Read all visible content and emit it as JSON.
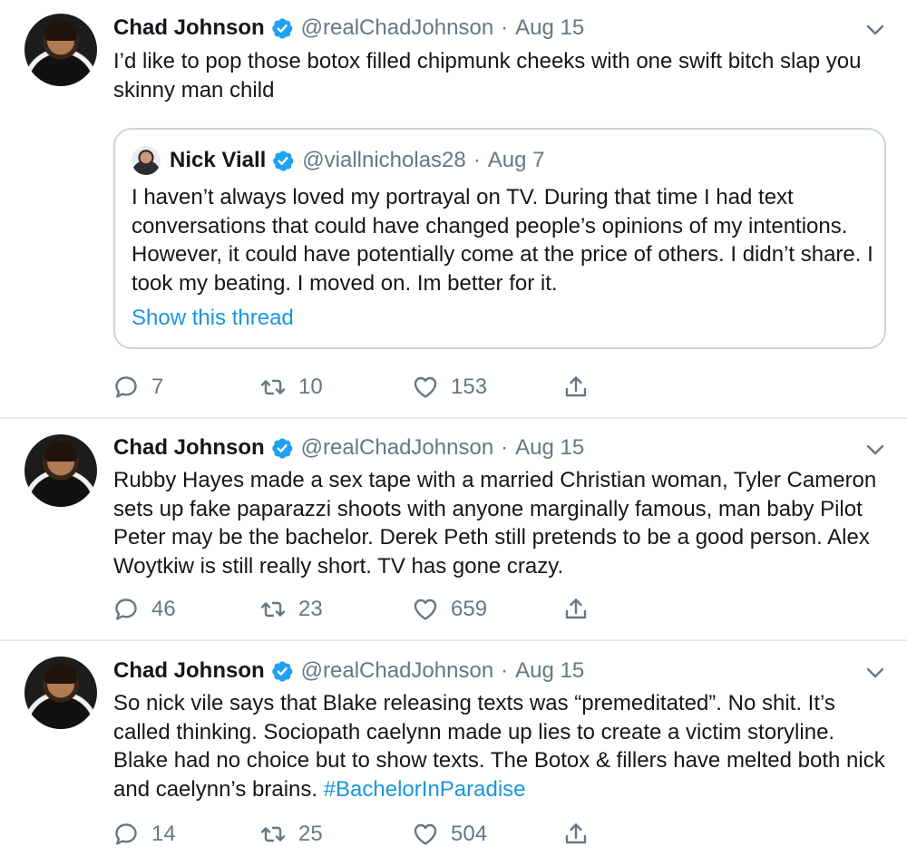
{
  "colors": {
    "link": "#1b95e0",
    "muted": "#657786",
    "text": "#14171a",
    "border": "#ccd6dd"
  },
  "icons": {
    "verified": "verified-badge-icon",
    "caret": "chevron-down-icon",
    "reply": "reply-icon",
    "retweet": "retweet-icon",
    "like": "heart-icon",
    "share": "share-icon"
  },
  "tweets": [
    {
      "author": {
        "name": "Chad Johnson",
        "handle": "@realChadJohnson",
        "separator": "·",
        "date": "Aug 15"
      },
      "text": "I’d like to pop those botox filled chipmunk cheeks with one swift bitch slap you skinny man child",
      "quote": {
        "author": {
          "name": "Nick Viall",
          "handle": "@viallnicholas28",
          "separator": "·",
          "date": "Aug 7"
        },
        "text": "I haven’t always loved my portrayal on TV.  During that time I had text conversations that could have changed people’s opinions of my intentions. However, it could have potentially come at the price of others.  I didn’t share.  I took my beating. I moved on.  Im better for it.",
        "link": "Show this thread"
      },
      "stats": {
        "replies": "7",
        "retweets": "10",
        "likes": "153"
      }
    },
    {
      "author": {
        "name": "Chad Johnson",
        "handle": "@realChadJohnson",
        "separator": "·",
        "date": "Aug 15"
      },
      "text": "Rubby Hayes made a sex tape with a married Christian woman, Tyler Cameron sets up fake paparazzi shoots with anyone marginally famous, man baby Pilot Peter may be the bachelor. Derek Peth still pretends to be a good person. Alex Woytkiw is still really short. TV has gone crazy.",
      "stats": {
        "replies": "46",
        "retweets": "23",
        "likes": "659"
      }
    },
    {
      "author": {
        "name": "Chad Johnson",
        "handle": "@realChadJohnson",
        "separator": "·",
        "date": "Aug 15"
      },
      "text": "So nick vile says that Blake releasing texts was “premeditated”. No shit. It’s called thinking. Sociopath caelynn made up lies to create a victim storyline. Blake had no choice but to show texts. The Botox & fillers have melted both nick and caelynn’s brains. ",
      "hashtag": "#BachelorInParadise",
      "stats": {
        "replies": "14",
        "retweets": "25",
        "likes": "504"
      }
    }
  ]
}
